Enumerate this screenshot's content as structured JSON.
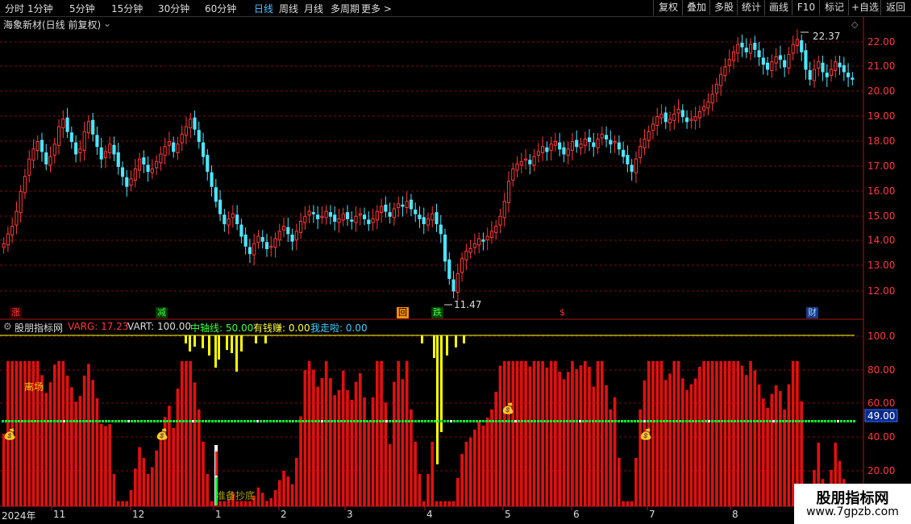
{
  "toolbar": {
    "periods": [
      "分时",
      "1分钟",
      "5分钟",
      "15分钟",
      "30分钟",
      "60分钟",
      "日线",
      "周线",
      "月线",
      "多周期",
      "更多 >"
    ],
    "active_period": "日线",
    "right_buttons": [
      "复权",
      "叠加",
      "多股",
      "统计",
      "画线",
      "F10",
      "标记",
      "+自选",
      "返回"
    ]
  },
  "main_chart": {
    "title": "海象新材(日线 前复权)",
    "price_labels": [
      "22.00",
      "21.00",
      "20.00",
      "19.00",
      "18.00",
      "17.00",
      "16.00",
      "15.00",
      "14.00",
      "13.00",
      "12.00"
    ],
    "high_label": "22.37",
    "low_label": "11.47",
    "signals": [
      "涨",
      "减",
      "回",
      "跌",
      "$",
      "财"
    ]
  },
  "indicator": {
    "name": "股朋指标网",
    "varg": "VARG: 17.23",
    "vart": "VART: 100.00",
    "mid": "中轴线: 50.00",
    "youqian": "有钱赚: 0.00",
    "wozou": "我走啦: 0.00",
    "axis_labels": [
      "100.0",
      "80.00",
      "60.00",
      "40.00",
      "20.00"
    ],
    "current_value": "49.00",
    "label_likai": "离场",
    "label_zhunbei": "准备抄底"
  },
  "x_axis": {
    "labels": [
      "2024年",
      "11",
      "12",
      "1",
      "2",
      "3",
      "4",
      "5",
      "6",
      "7",
      "8"
    ]
  },
  "watermark": {
    "title": "股朋指标网",
    "url": "www.7gpzb.com"
  },
  "colors": {
    "up": "#ff3a3a",
    "down": "#4ee6ff",
    "bar": "#e01010",
    "yellow": "#ffff00",
    "green": "#00ff33"
  },
  "chart_data": {
    "type": "candlestick",
    "price_range": [
      11.3,
      22.6
    ],
    "closes": [
      13.9,
      14.3,
      14.6,
      15.2,
      16.0,
      16.6,
      17.3,
      17.7,
      18.0,
      17.6,
      17.1,
      17.4,
      17.9,
      18.6,
      18.9,
      18.4,
      18.0,
      17.5,
      17.7,
      18.4,
      18.8,
      18.3,
      17.8,
      17.3,
      17.6,
      17.9,
      17.5,
      17.0,
      16.6,
      16.2,
      16.5,
      16.9,
      17.3,
      17.1,
      16.8,
      16.9,
      17.2,
      17.5,
      17.8,
      18.0,
      17.6,
      17.9,
      18.3,
      18.6,
      18.9,
      18.5,
      18.0,
      17.4,
      16.8,
      16.2,
      15.6,
      15.1,
      14.7,
      14.9,
      15.1,
      14.7,
      14.2,
      13.8,
      13.5,
      13.9,
      14.2,
      14.0,
      13.7,
      13.8,
      14.1,
      14.4,
      14.6,
      14.3,
      14.0,
      14.4,
      14.8,
      15.0,
      15.2,
      15.1,
      14.9,
      15.0,
      15.2,
      15.0,
      14.8,
      14.9,
      15.1,
      14.9,
      14.8,
      15.0,
      15.1,
      14.9,
      14.7,
      14.9,
      15.2,
      15.4,
      15.2,
      15.0,
      15.3,
      15.5,
      15.4,
      15.6,
      15.3,
      15.1,
      14.9,
      14.7,
      14.9,
      15.1,
      14.7,
      14.3,
      13.2,
      12.5,
      12.0,
      12.7,
      13.3,
      13.6,
      13.7,
      13.9,
      14.1,
      14.0,
      14.2,
      14.4,
      14.6,
      15.0,
      15.6,
      16.4,
      16.9,
      17.1,
      17.2,
      17.3,
      17.1,
      17.4,
      17.6,
      17.8,
      17.6,
      17.9,
      18.0,
      17.7,
      17.5,
      17.7,
      18.0,
      17.8,
      17.9,
      18.1,
      18.0,
      17.8,
      18.1,
      18.3,
      18.1,
      17.9,
      18.0,
      17.7,
      17.4,
      17.1,
      16.8,
      17.3,
      17.8,
      18.1,
      18.4,
      18.7,
      19.0,
      19.1,
      18.8,
      18.9,
      19.1,
      19.3,
      19.0,
      18.8,
      18.9,
      19.0,
      19.2,
      19.4,
      19.6,
      19.9,
      20.3,
      20.7,
      21.0,
      21.3,
      21.6,
      21.9,
      21.8,
      21.6,
      21.9,
      21.7,
      21.4,
      21.1,
      20.9,
      21.2,
      21.4,
      21.3,
      21.0,
      21.5,
      21.9,
      22.1,
      21.6,
      20.9,
      20.5,
      20.9,
      21.2,
      20.8,
      20.6,
      20.9,
      21.2,
      21.0,
      20.8,
      20.6,
      20.5
    ]
  }
}
